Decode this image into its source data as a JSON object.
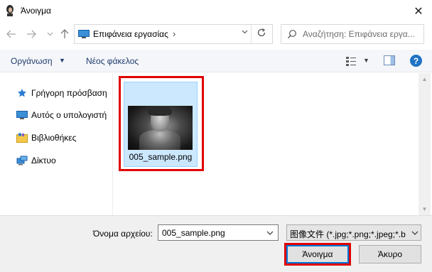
{
  "window": {
    "title": "Άνοιγμα",
    "close_glyph": "✕"
  },
  "nav": {
    "back_icon": "back-arrow-icon",
    "forward_icon": "forward-arrow-icon",
    "recent_icon": "chevron-down-icon",
    "up_icon": "up-arrow-icon",
    "address": "Επιφάνεια εργασίας",
    "address_chevron": "›",
    "search_placeholder": "Αναζήτηση: Επιφάνεια εργα..."
  },
  "toolbar": {
    "organize_label": "Οργάνωση",
    "new_folder_label": "Νέος φάκελος",
    "help_label": "?"
  },
  "sidebar": {
    "items": [
      {
        "label": "Γρήγορη πρόσβαση",
        "icon": "star-icon"
      },
      {
        "label": "Αυτός ο υπολογιστή",
        "icon": "computer-icon"
      },
      {
        "label": "Βιβλιοθήκες",
        "icon": "library-icon"
      },
      {
        "label": "Δίκτυο",
        "icon": "network-icon"
      }
    ]
  },
  "files": [
    {
      "name": "005_sample.png",
      "selected": true
    }
  ],
  "footer": {
    "filename_label": "Όνομα αρχείου:",
    "filename_value": "005_sample.png",
    "filter_value": "图像文件 (*.jpg;*.png;*.jpeg;*.b",
    "open_label": "Άνοιγμα",
    "cancel_label": "Άκυρο"
  },
  "colors": {
    "selection": "#cce8ff",
    "highlight_box": "#e00000",
    "accent": "#0078d7"
  }
}
